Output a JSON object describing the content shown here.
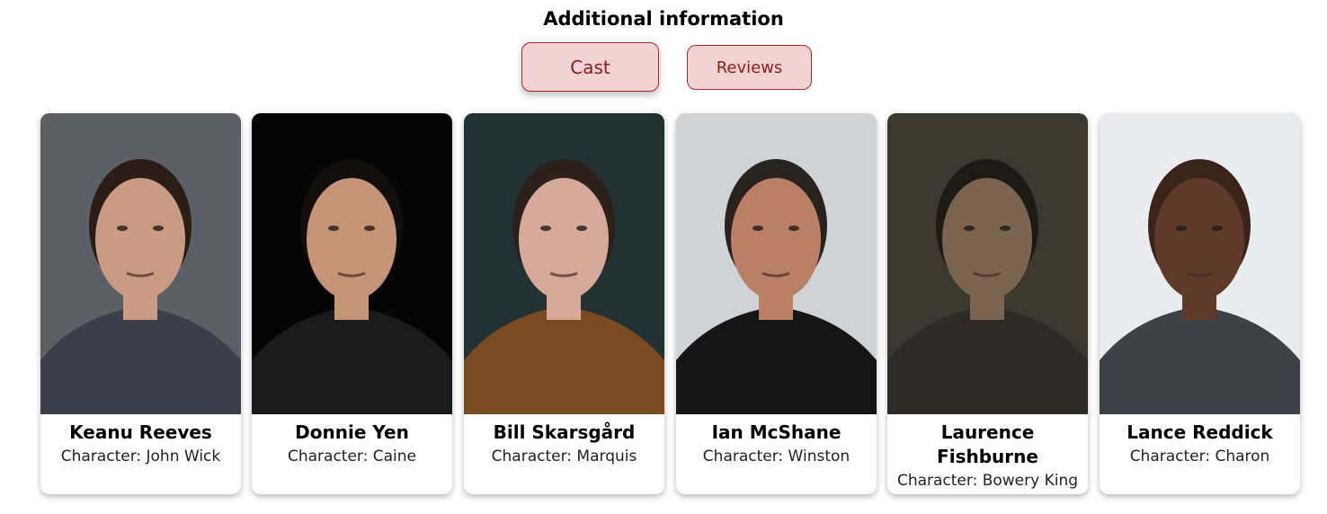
{
  "section_title": "Additional information",
  "tabs": {
    "cast": "Cast",
    "reviews": "Reviews"
  },
  "cast": [
    {
      "name": "Keanu Reeves",
      "character": "Character: John Wick",
      "colors": {
        "bg": "#5b5f66",
        "skin": "#c99b82",
        "hair": "#2a1d16",
        "cloth": "#3b3f4a"
      }
    },
    {
      "name": "Donnie Yen",
      "character": "Character: Caine",
      "colors": {
        "bg": "#050505",
        "skin": "#c69577",
        "hair": "#120e0c",
        "cloth": "#1a1a1a"
      }
    },
    {
      "name": "Bill Skarsgård",
      "character": "Character: Marquis",
      "colors": {
        "bg": "#223234",
        "skin": "#d6a99a",
        "hair": "#2b201a",
        "cloth": "#7a4a22"
      }
    },
    {
      "name": "Ian McShane",
      "character": "Character: Winston",
      "colors": {
        "bg": "#cfd3d6",
        "skin": "#b98067",
        "hair": "#2a221e",
        "cloth": "#151515"
      }
    },
    {
      "name": "Laurence Fishburne",
      "character": "Character: Bowery King",
      "colors": {
        "bg": "#3c3830",
        "skin": "#7a6450",
        "hair": "#1d1a16",
        "cloth": "#2e2b26"
      }
    },
    {
      "name": "Lance Reddick",
      "character": "Character: Charon",
      "colors": {
        "bg": "#e9ebef",
        "skin": "#5e3a2a",
        "hair": "#3a2418",
        "cloth": "#3f4148"
      }
    }
  ]
}
